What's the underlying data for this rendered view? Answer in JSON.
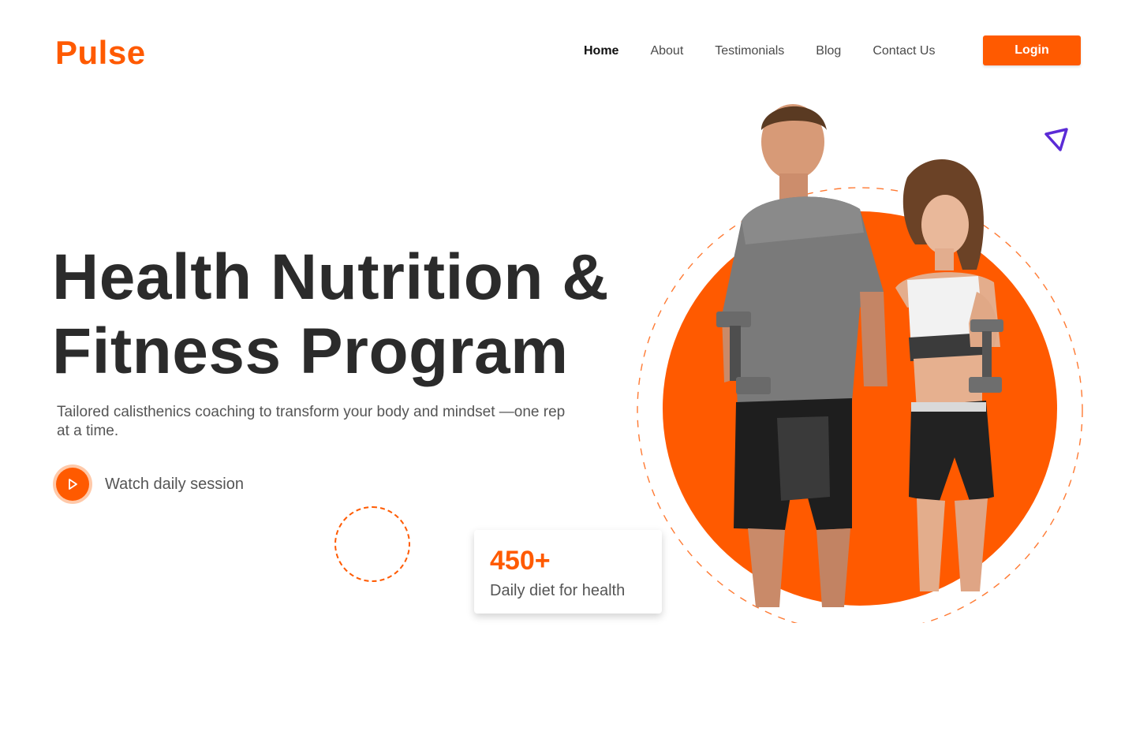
{
  "brand": {
    "name": "Pulse",
    "accent": "#ff5a00",
    "secondary": "#5b2bd6"
  },
  "nav": {
    "items": [
      {
        "label": "Home",
        "active": true
      },
      {
        "label": "About",
        "active": false
      },
      {
        "label": "Testimonials",
        "active": false
      },
      {
        "label": "Blog",
        "active": false
      },
      {
        "label": "Contact Us",
        "active": false
      }
    ],
    "login_label": "Login"
  },
  "hero": {
    "title_line1": "Health Nutrition &",
    "title_line2": "Fitness Program",
    "subtitle": "Tailored calisthenics coaching to transform your body and mindset —one rep at a time.",
    "watch_label": "Watch daily session",
    "play_icon": "play-icon"
  },
  "stat": {
    "number": "450+",
    "label": "Daily diet for health"
  },
  "decor": {
    "image_subject": "fitness-couple-with-dumbbells",
    "triangle_icon": "triangle-outline-icon"
  }
}
